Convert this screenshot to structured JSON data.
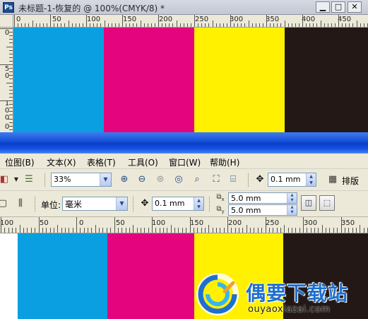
{
  "photoshop": {
    "logo": "Ps",
    "title": "未标题-1-恢复的 @ 100%(CMYK/8) *",
    "window_buttons": {
      "minimize": "▁",
      "maximize": "□",
      "close": "✕"
    },
    "hruler_labels": [
      "0",
      "50",
      "100",
      "150",
      "200",
      "250",
      "300",
      "350",
      "400",
      "450"
    ],
    "vruler_labels": [
      "0",
      "50",
      "100",
      "0"
    ],
    "swatch_colors": [
      "#0a9fe0",
      "#e4057e",
      "#fff100",
      "#231815"
    ]
  },
  "corel": {
    "menu": [
      "位图(B)",
      "文本(X)",
      "表格(T)",
      "工具(O)",
      "窗口(W)",
      "帮助(H)"
    ],
    "toolbar1": {
      "zoom_value": "33%",
      "nudge_value": "0.1 mm",
      "layout_label": "排版"
    },
    "toolbar2": {
      "unit_label": "单位:",
      "unit_value": "毫米",
      "nudge_value": "0.1 mm",
      "dup_x": "5.0 mm",
      "dup_y": "5.0 mm",
      "x_sub": "x",
      "y_sub": "y"
    },
    "ruler_labels": [
      "100",
      "50",
      "0",
      "50",
      "100",
      "150",
      "200",
      "250",
      "300",
      "350"
    ],
    "swatch_colors": [
      "#0a9fe0",
      "#e4057e",
      "#fff100",
      "#231815"
    ]
  },
  "watermark": {
    "title": "偶要下载站",
    "url": "ouyaoxiazai.com"
  }
}
